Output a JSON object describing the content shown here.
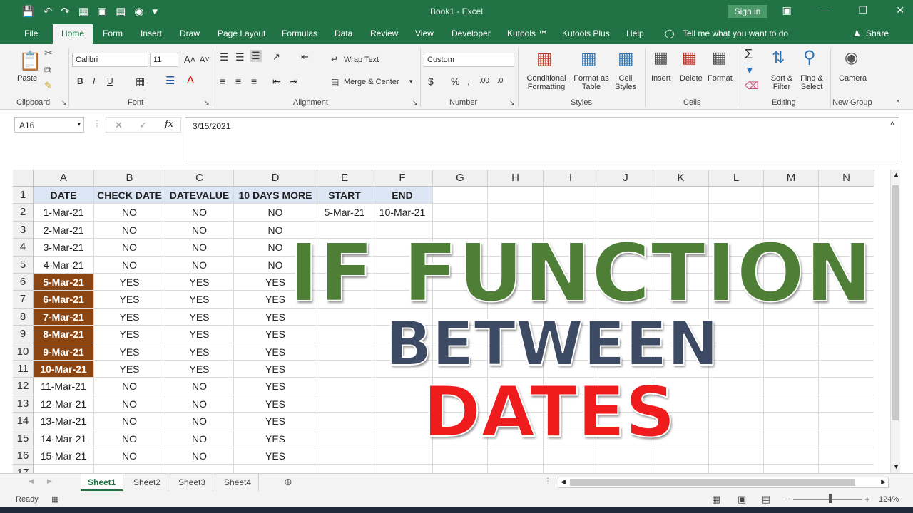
{
  "window": {
    "title": "Book1 - Excel",
    "signin": "Sign in"
  },
  "tabs": [
    "File",
    "Home",
    "Form",
    "Insert",
    "Draw",
    "Page Layout",
    "Formulas",
    "Data",
    "Review",
    "View",
    "Developer",
    "Kutools ™",
    "Kutools Plus",
    "Help"
  ],
  "tell_me": "Tell me what you want to do",
  "share": "Share",
  "ribbon": {
    "paste": "Paste",
    "clipboard": "Clipboard",
    "font_name": "Calibri",
    "font_size": "11",
    "font": "Font",
    "wrap_text": "Wrap Text",
    "merge_center": "Merge & Center",
    "alignment": "Alignment",
    "number_format": "Custom",
    "number": "Number",
    "conditional_formatting": "Conditional Formatting",
    "format_as_table": "Format as Table",
    "cell_styles": "Cell Styles",
    "styles": "Styles",
    "insert": "Insert",
    "delete": "Delete",
    "format": "Format",
    "cells": "Cells",
    "sort_filter": "Sort & Filter",
    "find_select": "Find & Select",
    "editing": "Editing",
    "camera": "Camera",
    "new_group": "New Group"
  },
  "formula_bar": {
    "name_box": "A16",
    "formula": "3/15/2021"
  },
  "columns": [
    "A",
    "B",
    "C",
    "D",
    "E",
    "F",
    "G",
    "H",
    "I",
    "J",
    "K",
    "L",
    "M",
    "N"
  ],
  "rows": [
    [
      "DATE",
      "CHECK DATE",
      "DATEVALUE",
      "10 DAYS MORE",
      "START",
      "END"
    ],
    [
      "1-Mar-21",
      "NO",
      "NO",
      "NO",
      "5-Mar-21",
      "10-Mar-21"
    ],
    [
      "2-Mar-21",
      "NO",
      "NO",
      "NO",
      "",
      ""
    ],
    [
      "3-Mar-21",
      "NO",
      "NO",
      "NO",
      "",
      ""
    ],
    [
      "4-Mar-21",
      "NO",
      "NO",
      "NO",
      "",
      ""
    ],
    [
      "5-Mar-21",
      "YES",
      "YES",
      "YES",
      "",
      ""
    ],
    [
      "6-Mar-21",
      "YES",
      "YES",
      "YES",
      "",
      ""
    ],
    [
      "7-Mar-21",
      "YES",
      "YES",
      "YES",
      "",
      ""
    ],
    [
      "8-Mar-21",
      "YES",
      "YES",
      "YES",
      "",
      ""
    ],
    [
      "9-Mar-21",
      "YES",
      "YES",
      "YES",
      "",
      ""
    ],
    [
      "10-Mar-21",
      "YES",
      "YES",
      "YES",
      "",
      ""
    ],
    [
      "11-Mar-21",
      "NO",
      "NO",
      "YES",
      "",
      ""
    ],
    [
      "12-Mar-21",
      "NO",
      "NO",
      "YES",
      "",
      ""
    ],
    [
      "13-Mar-21",
      "NO",
      "NO",
      "YES",
      "",
      ""
    ],
    [
      "14-Mar-21",
      "NO",
      "NO",
      "YES",
      "",
      ""
    ],
    [
      "15-Mar-21",
      "NO",
      "NO",
      "YES",
      "",
      ""
    ]
  ],
  "highlighted_rows": [
    6,
    7,
    8,
    9,
    10,
    11
  ],
  "overlay": {
    "line1": "IF FUNCTION",
    "line2": "BETWEEN",
    "line3": "DATES",
    "color1": "#4f7f36",
    "color2": "#3d4a63",
    "color3": "#ee1c1c"
  },
  "sheets": [
    "Sheet1",
    "Sheet2",
    "Sheet3",
    "Sheet4"
  ],
  "status": {
    "ready": "Ready",
    "zoom": "124%"
  },
  "colors": {
    "accent": "#217346",
    "date_highlight": "#8b4513",
    "header_fill": "#dde6f4"
  }
}
